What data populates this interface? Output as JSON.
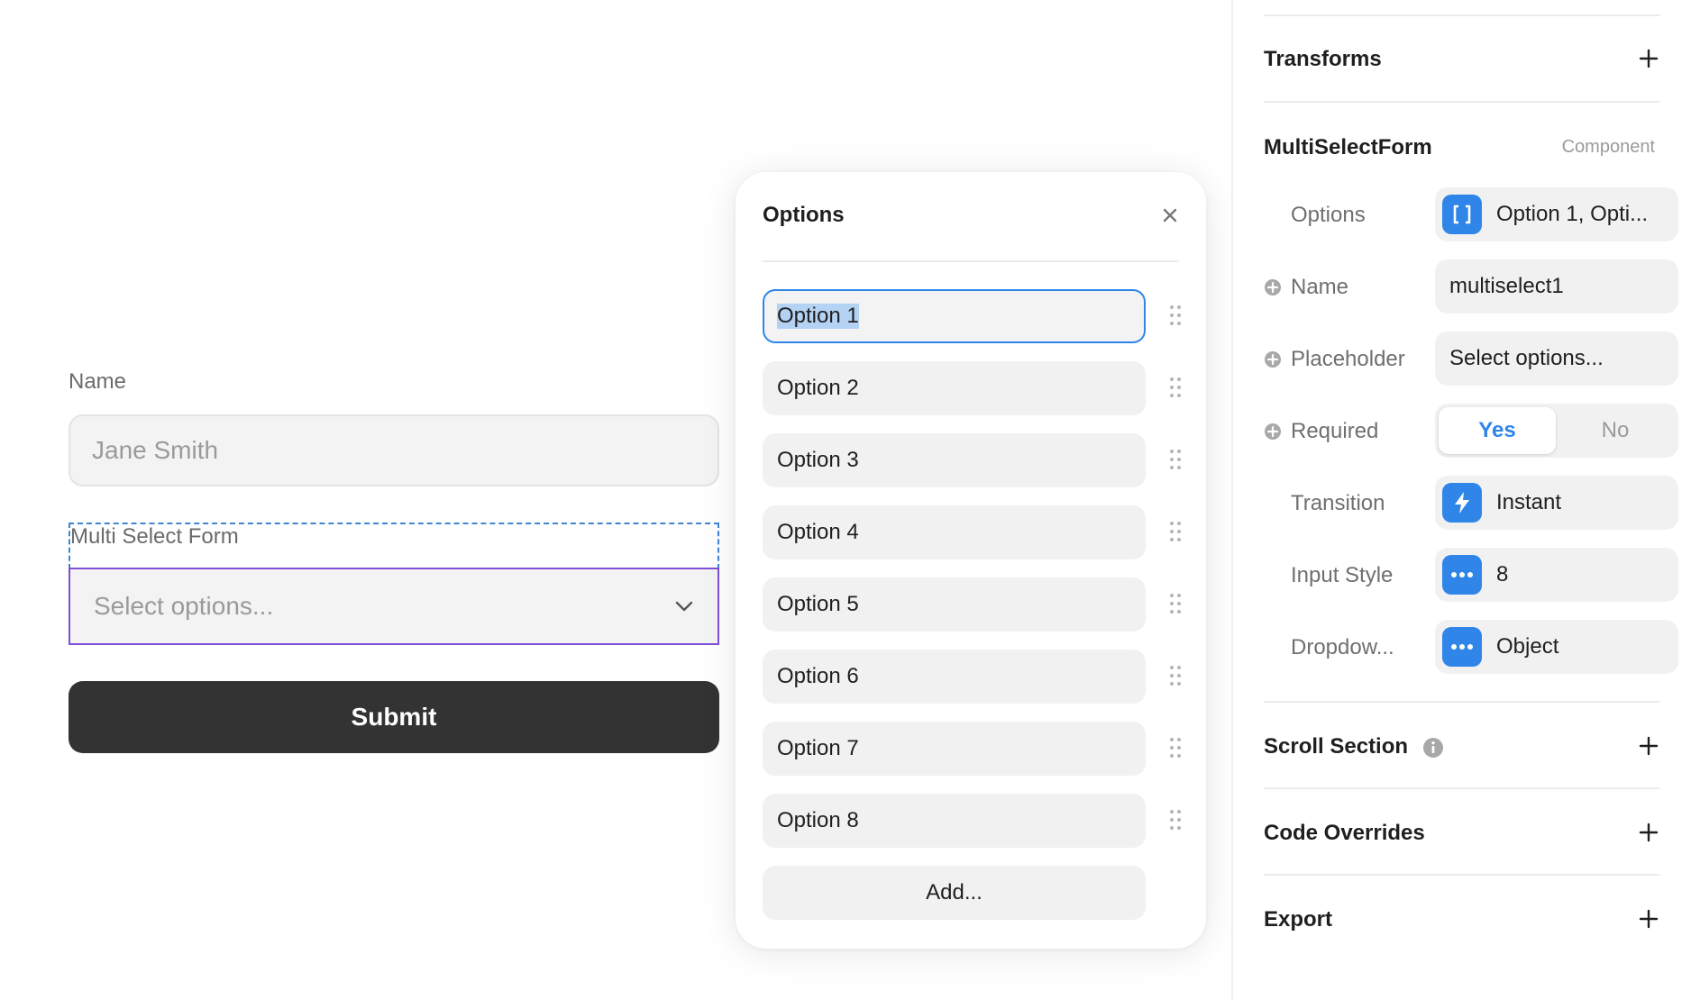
{
  "form": {
    "name_label": "Name",
    "name_value": "Jane Smith",
    "multiselect_label": "Multi Select Form",
    "multiselect_placeholder": "Select options...",
    "submit_label": "Submit"
  },
  "options_popover": {
    "title": "Options",
    "options": [
      "Option 1",
      "Option 2",
      "Option 3",
      "Option 4",
      "Option 5",
      "Option 6",
      "Option 7",
      "Option 8"
    ],
    "add_label": "Add..."
  },
  "panel": {
    "transforms_title": "Transforms",
    "component_title": "MultiSelectForm",
    "component_tag": "Component",
    "rows": {
      "options_label": "Options",
      "options_value": "Option 1, Opti...",
      "name_label": "Name",
      "name_value": "multiselect1",
      "placeholder_label": "Placeholder",
      "placeholder_value": "Select options...",
      "required_label": "Required",
      "required_yes": "Yes",
      "required_no": "No",
      "transition_label": "Transition",
      "transition_value": "Instant",
      "input_style_label": "Input Style",
      "input_style_value": "8",
      "dropdown_label": "Dropdow...",
      "dropdown_value": "Object"
    },
    "scroll_section_title": "Scroll Section",
    "code_overrides_title": "Code Overrides",
    "export_title": "Export"
  },
  "colors": {
    "accent_blue": "#2f86e8",
    "selection_purple": "#7e4ed8",
    "submit_dark": "#333333"
  }
}
